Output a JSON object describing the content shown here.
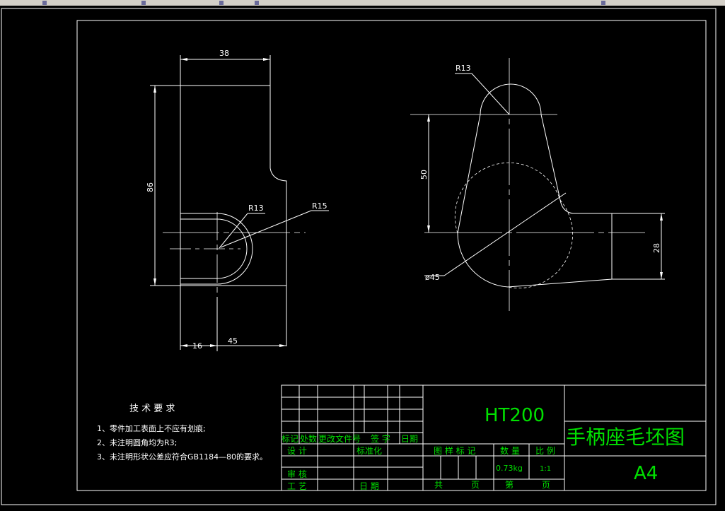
{
  "colors": {
    "background": "#000000",
    "geometry": "#ffffff",
    "titleblock_text": "#00e000"
  },
  "drawing": {
    "front_view": {
      "dim_width": "38",
      "dim_height": "86",
      "dim_r13": "R13",
      "dim_r15": "R15",
      "dim_16": "16",
      "dim_45": "45"
    },
    "side_view": {
      "dim_r13": "R13",
      "dim_50": "50",
      "dim_dia45": "ø45",
      "dim_28": "28"
    }
  },
  "notes": {
    "title": "技 术 要 求",
    "items": [
      "1、零件加工表面上不应有划痕;",
      "2、未注明圆角均为R3;",
      "3、未注明形状公差应符合GB1184—80的要求。"
    ]
  },
  "title_block": {
    "material": "HT200",
    "part_name": "手柄座毛坯图",
    "sheet_size": "A4",
    "rev_headers": [
      "标记",
      "处数",
      "更改文件号",
      "签 字",
      "日期"
    ],
    "design": "设 计",
    "standardize": "标准化",
    "review": "审 核",
    "process": "工 艺",
    "date": "日 期",
    "stage_mark": "图 样 标 记",
    "quantity_label": "数 量",
    "scale_label": "比 例",
    "weight": "0.73kg",
    "scale": "1:1",
    "total": "共",
    "page": "页",
    "sheet_no": "第",
    "page2": "页"
  }
}
